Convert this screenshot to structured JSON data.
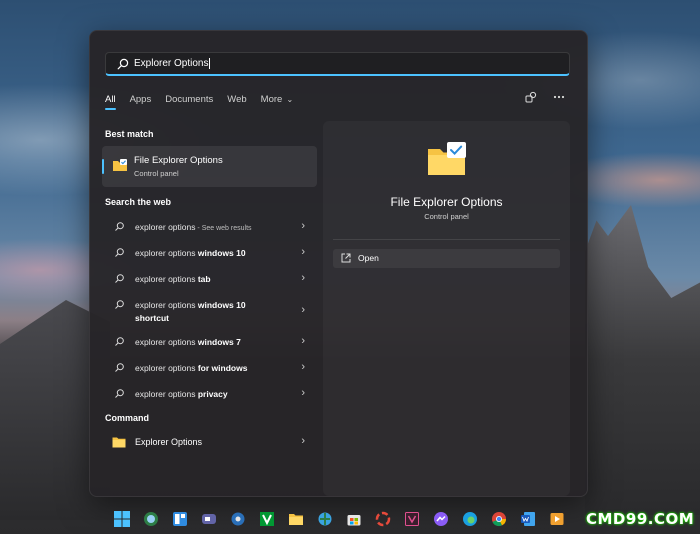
{
  "search": {
    "query": "Explorer Options"
  },
  "tabs": [
    {
      "label": "All"
    },
    {
      "label": "Apps"
    },
    {
      "label": "Documents"
    },
    {
      "label": "Web"
    },
    {
      "label": "More"
    }
  ],
  "best_match": {
    "heading": "Best match",
    "title": "File Explorer Options",
    "subtitle": "Control panel"
  },
  "web": {
    "heading": "Search the web",
    "items": [
      {
        "base": "explorer options",
        "bold": "",
        "suffix": " - See web results"
      },
      {
        "base": "explorer options ",
        "bold": "windows 10",
        "suffix": ""
      },
      {
        "base": "explorer options ",
        "bold": "tab",
        "suffix": ""
      },
      {
        "base": "explorer options ",
        "bold": "windows 10 shortcut",
        "suffix": ""
      },
      {
        "base": "explorer options ",
        "bold": "windows 7",
        "suffix": ""
      },
      {
        "base": "explorer options ",
        "bold": "for windows",
        "suffix": ""
      },
      {
        "base": "explorer options ",
        "bold": "privacy",
        "suffix": ""
      }
    ]
  },
  "command": {
    "heading": "Command",
    "item_label": "Explorer Options"
  },
  "detail": {
    "title": "File Explorer Options",
    "subtitle": "Control panel",
    "open_label": "Open"
  },
  "taskbar_icons": [
    "windows-start-icon",
    "search-icon",
    "widgets-icon",
    "teams-chat-icon",
    "settings-icon",
    "vim-icon",
    "file-explorer-icon",
    "network-globe-icon",
    "store-icon",
    "photos-icon",
    "media-icon",
    "messenger-icon",
    "edge-icon",
    "chrome-icon",
    "word-icon",
    "media-player-icon"
  ],
  "watermark": "CMD99.COM",
  "colors": {
    "accent": "#4cc2ff",
    "panel": "#262428",
    "folder": "#f6c343"
  }
}
